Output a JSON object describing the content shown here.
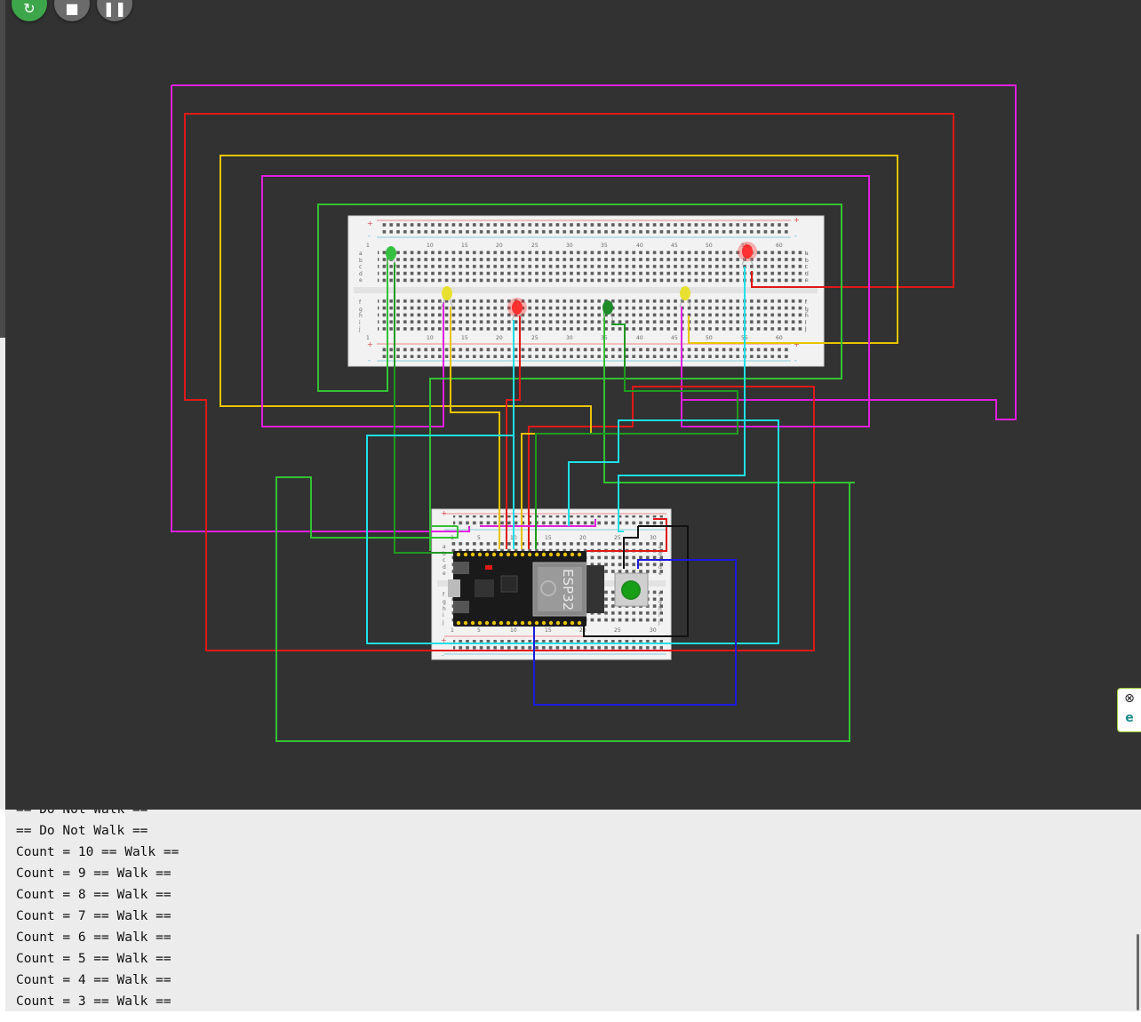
{
  "controls": {
    "restart": {
      "icon": "restart-icon",
      "glyph": "↻",
      "color": "#3ea64a"
    },
    "stop": {
      "icon": "stop-icon",
      "glyph": "■",
      "color": "#6b6b6b"
    },
    "pause": {
      "icon": "pause-icon",
      "glyph": "❚❚",
      "color": "#6b6b6b"
    }
  },
  "canvas": {
    "background": "#323232"
  },
  "breadboard_top": {
    "column_numbers": [
      "1",
      "10",
      "15",
      "20",
      "25",
      "30",
      "35",
      "40",
      "45",
      "50",
      "55",
      "60"
    ],
    "row_letters_top": [
      "a",
      "b",
      "c",
      "d",
      "e"
    ],
    "row_letters_bottom": [
      "f",
      "g",
      "h",
      "i",
      "j"
    ],
    "rail_plus": "+",
    "rail_minus": "-"
  },
  "breadboard_bottom": {
    "column_numbers": [
      "1",
      "5",
      "10",
      "15",
      "20",
      "25",
      "30"
    ],
    "row_letters_top": [
      "a",
      "b",
      "c",
      "d",
      "e"
    ],
    "row_letters_bottom": [
      "f",
      "g",
      "h",
      "i",
      "j"
    ],
    "rail_plus": "+",
    "rail_minus": "-"
  },
  "board": {
    "label": "ESP32"
  },
  "leds": [
    {
      "name": "green-led-1",
      "color": "#34c040"
    },
    {
      "name": "red-led-1",
      "color": "#ff3030"
    },
    {
      "name": "yellow-led-1",
      "color": "#e8e030"
    },
    {
      "name": "red-led-2",
      "color": "#ff3030"
    },
    {
      "name": "green-led-2",
      "color": "#1f8a2a"
    },
    {
      "name": "yellow-led-2",
      "color": "#e8e030"
    }
  ],
  "side_tools": {
    "close": "⊗",
    "edge": "e"
  },
  "serial_monitor": {
    "lines": [
      "== Do Not Walk ==",
      "== Do Not Walk ==",
      "Count = 10 == Walk ==",
      "Count = 9 == Walk ==",
      "Count = 8 == Walk ==",
      "Count = 7 == Walk ==",
      "Count = 6 == Walk ==",
      "Count = 5 == Walk ==",
      "Count = 4 == Walk ==",
      "Count = 3 == Walk =="
    ]
  },
  "wire_colors": {
    "magenta": "#e020e0",
    "red": "#e01818",
    "yellow": "#e8c400",
    "green": "#33c233",
    "cyan": "#1ee0e8",
    "blue": "#1a1ae0",
    "black": "#111111"
  }
}
